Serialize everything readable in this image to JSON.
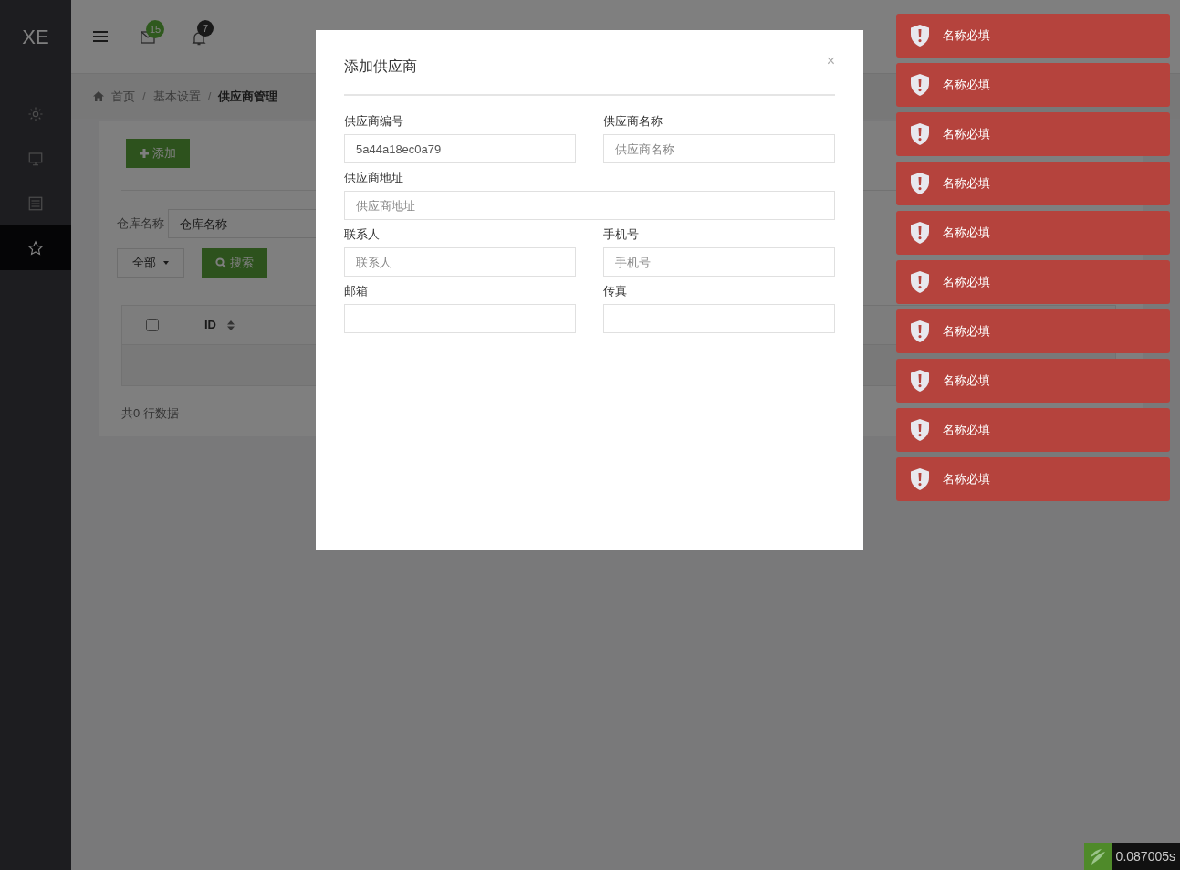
{
  "sidebar": {
    "logo": "XE",
    "items": [
      {
        "selected": false
      },
      {
        "selected": false
      },
      {
        "selected": false
      },
      {
        "selected": true
      }
    ]
  },
  "header": {
    "mail_count": "15",
    "notice_count": "7"
  },
  "breadcrumb": {
    "separator": "/",
    "items": [
      {
        "label": "首页",
        "current": false
      },
      {
        "label": "基本设置",
        "current": false
      },
      {
        "label": "供应商管理",
        "current": true
      }
    ]
  },
  "toolbar": {
    "add_button": "添加"
  },
  "filters": {
    "warehouse_label": "仓库名称",
    "warehouse_placeholder": "仓库名称",
    "status_select": "全部",
    "search_button": "搜索"
  },
  "table": {
    "columns": [
      {
        "kind": "checkbox",
        "checked": false
      },
      {
        "kind": "sortable",
        "label": "ID"
      }
    ]
  },
  "footer": "共0 行数据",
  "modal": {
    "title": "添加供应商",
    "close": "×",
    "fields": [
      {
        "label": "供应商编号",
        "value": "5a44a18ec0a79",
        "kind": "half"
      },
      {
        "label": "供应商名称",
        "placeholder": "供应商名称",
        "kind": "half"
      },
      {
        "label": "供应商地址",
        "placeholder": "供应商地址",
        "kind": "wide"
      },
      {
        "label": "联系人",
        "placeholder": "联系人",
        "kind": "half"
      },
      {
        "label": "手机号",
        "placeholder": "手机号",
        "kind": "half"
      },
      {
        "label": "邮箱",
        "kind": "half"
      },
      {
        "label": "传真",
        "kind": "half"
      }
    ]
  },
  "toasts": [
    {
      "message": "名称必填"
    },
    {
      "message": "名称必填"
    },
    {
      "message": "名称必填"
    },
    {
      "message": "名称必填"
    },
    {
      "message": "名称必填"
    },
    {
      "message": "名称必填"
    },
    {
      "message": "名称必填"
    },
    {
      "message": "名称必填"
    },
    {
      "message": "名称必填"
    },
    {
      "message": "名称必填"
    }
  ],
  "timer": "0.087005s"
}
